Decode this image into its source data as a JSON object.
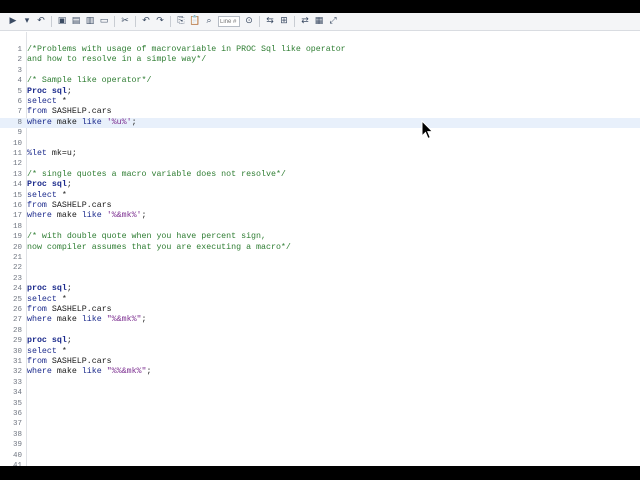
{
  "toolbar": {
    "buttons": [
      {
        "name": "run-icon",
        "glyph": "▶"
      },
      {
        "name": "run-dropdown-icon",
        "glyph": "▾"
      },
      {
        "name": "recall-icon",
        "glyph": "↶"
      },
      {
        "name": "open-icon",
        "glyph": "▣"
      },
      {
        "name": "save-icon",
        "glyph": "▤"
      },
      {
        "name": "save-as-icon",
        "glyph": "▥"
      },
      {
        "name": "new-icon",
        "glyph": "▭"
      },
      {
        "name": "cut-icon",
        "glyph": "✂"
      },
      {
        "name": "undo-icon",
        "glyph": "↶"
      },
      {
        "name": "redo-icon",
        "glyph": "↷"
      },
      {
        "name": "copy-icon",
        "glyph": "⎘"
      },
      {
        "name": "paste-icon",
        "glyph": "📋"
      },
      {
        "name": "find-icon",
        "glyph": "⌕"
      }
    ],
    "line_placeholder": "Line #",
    "buttons_right": [
      {
        "name": "go-to-line-icon",
        "glyph": "⊙"
      },
      {
        "name": "format-code-icon",
        "glyph": "⇆"
      },
      {
        "name": "snippet-icon",
        "glyph": "⊞"
      },
      {
        "name": "toggle-icon",
        "glyph": "⇄"
      },
      {
        "name": "options-icon",
        "glyph": "▦"
      },
      {
        "name": "maximize-icon",
        "glyph": "⤢"
      }
    ]
  },
  "editor": {
    "current_line": 8,
    "lines": [
      {
        "n": "1",
        "t": "/*Problems with usage of macrovariable in PROC Sql like operator"
      },
      {
        "n": "2",
        "t": "and how to resolve in a simple way*/"
      },
      {
        "n": "3",
        "t": ""
      },
      {
        "n": "4",
        "t": "/* Sample like operator*/"
      },
      {
        "n": "5",
        "t": "Proc sql;"
      },
      {
        "n": "6",
        "t": "select *"
      },
      {
        "n": "7",
        "t": "from SASHELP.cars"
      },
      {
        "n": "8",
        "t": "where make like '%u%';"
      },
      {
        "n": "9",
        "t": ""
      },
      {
        "n": "10",
        "t": ""
      },
      {
        "n": "11",
        "t": "%let mk=u;"
      },
      {
        "n": "12",
        "t": ""
      },
      {
        "n": "13",
        "t": "/* single quotes a macro variable does not resolve*/"
      },
      {
        "n": "14",
        "t": "Proc sql;"
      },
      {
        "n": "15",
        "t": "select *"
      },
      {
        "n": "16",
        "t": "from SASHELP.cars"
      },
      {
        "n": "17",
        "t": "where make like '%&mk%';"
      },
      {
        "n": "18",
        "t": ""
      },
      {
        "n": "19",
        "t": "/* with double quote when you have percent sign,"
      },
      {
        "n": "20",
        "t": "now compiler assumes that you are executing a macro*/"
      },
      {
        "n": "21",
        "t": ""
      },
      {
        "n": "22",
        "t": ""
      },
      {
        "n": "23",
        "t": ""
      },
      {
        "n": "24",
        "t": "proc sql;"
      },
      {
        "n": "25",
        "t": "select *"
      },
      {
        "n": "26",
        "t": "from SASHELP.cars"
      },
      {
        "n": "27",
        "t": "where make like \"%&mk%\";"
      },
      {
        "n": "28",
        "t": ""
      },
      {
        "n": "29",
        "t": "proc sql;"
      },
      {
        "n": "30",
        "t": "select *"
      },
      {
        "n": "31",
        "t": "from SASHELP.cars"
      },
      {
        "n": "32",
        "t": "where make like \"%%&mk%\";"
      },
      {
        "n": "33",
        "t": ""
      },
      {
        "n": "34",
        "t": ""
      },
      {
        "n": "35",
        "t": ""
      },
      {
        "n": "36",
        "t": ""
      },
      {
        "n": "37",
        "t": ""
      },
      {
        "n": "38",
        "t": ""
      },
      {
        "n": "39",
        "t": ""
      },
      {
        "n": "40",
        "t": ""
      },
      {
        "n": "41",
        "t": ""
      }
    ]
  },
  "colors": {
    "keyword": "#1b2a8c",
    "comment": "#2e7d32",
    "string": "#7b2c8f",
    "current_line": "#e8f0fb"
  }
}
